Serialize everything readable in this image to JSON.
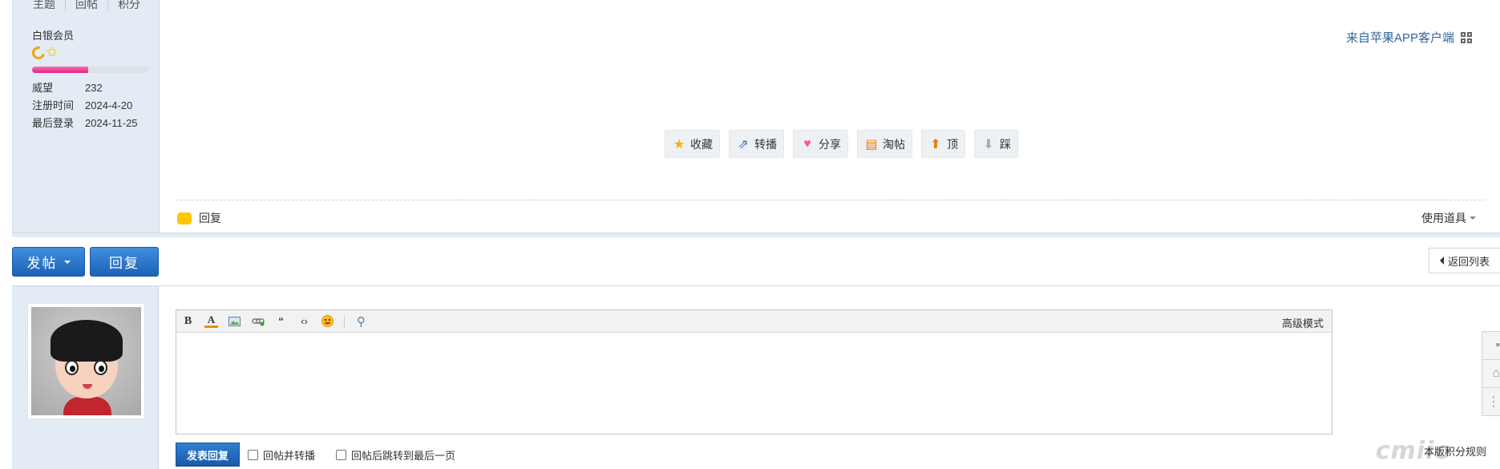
{
  "user": {
    "stat_tabs": [
      "主题",
      "回帖",
      "积分"
    ],
    "rank": "白银会员",
    "progress": 0.48,
    "info": [
      {
        "key": "威望",
        "value": "232"
      },
      {
        "key": "注册时间",
        "value": "2024-4-20"
      },
      {
        "key": "最后登录",
        "value": "2024-11-25"
      }
    ]
  },
  "post": {
    "from_app": "来自苹果APP客户端",
    "actions": [
      {
        "label": "收藏",
        "icon": "star-icon",
        "color": "#f5b301",
        "glyph": "★"
      },
      {
        "label": "转播",
        "icon": "share-arrow-icon",
        "color": "#3b6fb6",
        "glyph": "⇗"
      },
      {
        "label": "分享",
        "icon": "heart-icon",
        "color": "#ff5a8a",
        "glyph": "♥"
      },
      {
        "label": "淘帖",
        "icon": "tray-icon",
        "color": "#f07a00",
        "glyph": "▤"
      },
      {
        "label": "顶",
        "icon": "arrow-up-icon",
        "color": "#f07a00",
        "glyph": "⬆"
      },
      {
        "label": "踩",
        "icon": "arrow-down-icon",
        "color": "#aaaaaa",
        "glyph": "⬇"
      }
    ],
    "reply_label": "回复",
    "use_tool_label": "使用道具"
  },
  "toolbar": {
    "post_button": "发帖",
    "reply_button": "回复",
    "back_to_list": "返回列表"
  },
  "editor": {
    "advanced_mode": "高级模式",
    "submit_button": "发表回复",
    "checkbox_1": "回帖并转播",
    "checkbox_2": "回帖后跳转到最后一页",
    "rules_link": "本版积分规则",
    "watermark": "cmiio"
  },
  "colors": {
    "accent": "#1e62b4",
    "sidebar_bg": "#e3ebf4",
    "link": "#336699"
  }
}
